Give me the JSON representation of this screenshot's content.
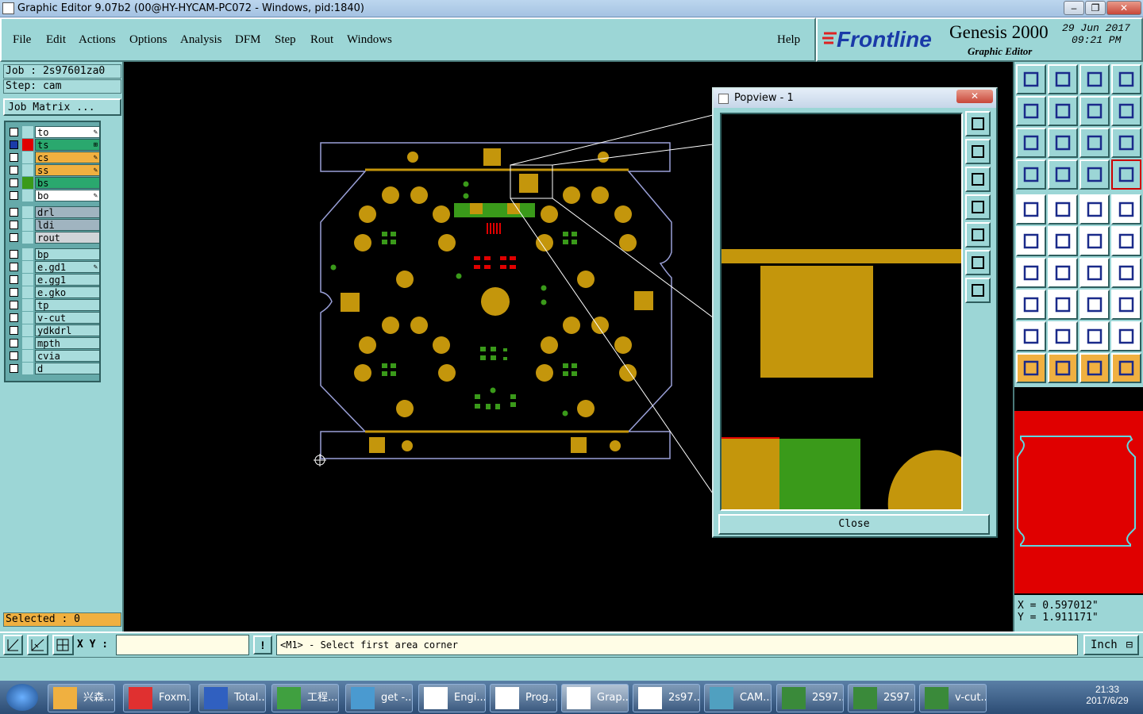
{
  "window": {
    "title": "Graphic Editor 9.07b2 (00@HY-HYCAM-PC072 - Windows, pid:1840)"
  },
  "menubar": {
    "items": [
      "File",
      "Edit",
      "Actions",
      "Options",
      "Analysis",
      "DFM",
      "Step",
      "Rout",
      "Windows"
    ],
    "help": "Help"
  },
  "brand": {
    "logo": "Frontline",
    "product": "Genesis 2000",
    "subtitle": "Graphic Editor",
    "date": "29 Jun 2017",
    "time": "09:21 PM"
  },
  "left": {
    "job": "Job : 2s97601za0",
    "step": "Step: cam",
    "job_matrix": "Job Matrix ...",
    "selected": "Selected : 0"
  },
  "layers": [
    {
      "name": "to",
      "bg": "#ffffff",
      "swatch": "#a8dcdc",
      "mark": "✎",
      "checked": false
    },
    {
      "name": "ts",
      "bg": "#2aa86e",
      "swatch": "#e00000",
      "mark": "⊞",
      "checked": true
    },
    {
      "name": "cs",
      "bg": "#f0b040",
      "swatch": "#a8dcdc",
      "mark": "✎",
      "checked": false
    },
    {
      "name": "ss",
      "bg": "#f0b040",
      "swatch": "#a8dcdc",
      "mark": "✎",
      "checked": false
    },
    {
      "name": "bs",
      "bg": "#2aa86e",
      "swatch": "#3a9a1a",
      "mark": "",
      "checked": false
    },
    {
      "name": "bo",
      "bg": "#ffffff",
      "swatch": "#a8dcdc",
      "mark": "✎",
      "checked": false
    },
    {
      "name": "drl",
      "bg": "#a0b4c0",
      "swatch": "#a8dcdc",
      "mark": "",
      "checked": false
    },
    {
      "name": "ldi",
      "bg": "#a0b4c0",
      "swatch": "#a8dcdc",
      "mark": "",
      "checked": false
    },
    {
      "name": "rout",
      "bg": "#d0d4d8",
      "swatch": "#a8dcdc",
      "mark": "",
      "checked": false
    },
    {
      "name": "bp",
      "bg": "#a8dcdc",
      "swatch": "#a8dcdc",
      "mark": "",
      "checked": false
    },
    {
      "name": "e.gd1",
      "bg": "#a8dcdc",
      "swatch": "#a8dcdc",
      "mark": "✎",
      "checked": false
    },
    {
      "name": "e.gg1",
      "bg": "#a8dcdc",
      "swatch": "#a8dcdc",
      "mark": "",
      "checked": false
    },
    {
      "name": "e.gko",
      "bg": "#a8dcdc",
      "swatch": "#a8dcdc",
      "mark": "",
      "checked": false
    },
    {
      "name": "tp",
      "bg": "#a8dcdc",
      "swatch": "#a8dcdc",
      "mark": "",
      "checked": false
    },
    {
      "name": "v-cut",
      "bg": "#a8dcdc",
      "swatch": "#a8dcdc",
      "mark": "",
      "checked": false
    },
    {
      "name": "ydkdrl",
      "bg": "#a8dcdc",
      "swatch": "#a8dcdc",
      "mark": "",
      "checked": false
    },
    {
      "name": "mpth",
      "bg": "#a8dcdc",
      "swatch": "#a8dcdc",
      "mark": "",
      "checked": false
    },
    {
      "name": "cvia",
      "bg": "#a8dcdc",
      "swatch": "#a8dcdc",
      "mark": "",
      "checked": false
    },
    {
      "name": "d",
      "bg": "#a8dcdc",
      "swatch": "#a8dcdc",
      "mark": "",
      "checked": false
    }
  ],
  "popview": {
    "title": "Popview - 1",
    "close_label": "Close"
  },
  "coords": {
    "x": "X = 0.597012\"",
    "y": "Y = 1.911171\""
  },
  "command": {
    "xy_label": "X Y :",
    "xy_value": "",
    "prompt": "<M1> - Select first area corner",
    "units": "Inch"
  },
  "taskbar": {
    "items": [
      "兴森...",
      "Foxm...",
      "Total...",
      "工程...",
      "get -...",
      "Engi...",
      "Prog...",
      "Grap...",
      "2s97...",
      "CAM...",
      "2S97...",
      "2S97...",
      "v-cut..."
    ],
    "clock_time": "21:33",
    "clock_date": "2017/6/29"
  },
  "colors": {
    "panel": "#9cd6d6",
    "pad": "#c4960c",
    "green": "#3a9a1a",
    "red": "#e00000"
  }
}
